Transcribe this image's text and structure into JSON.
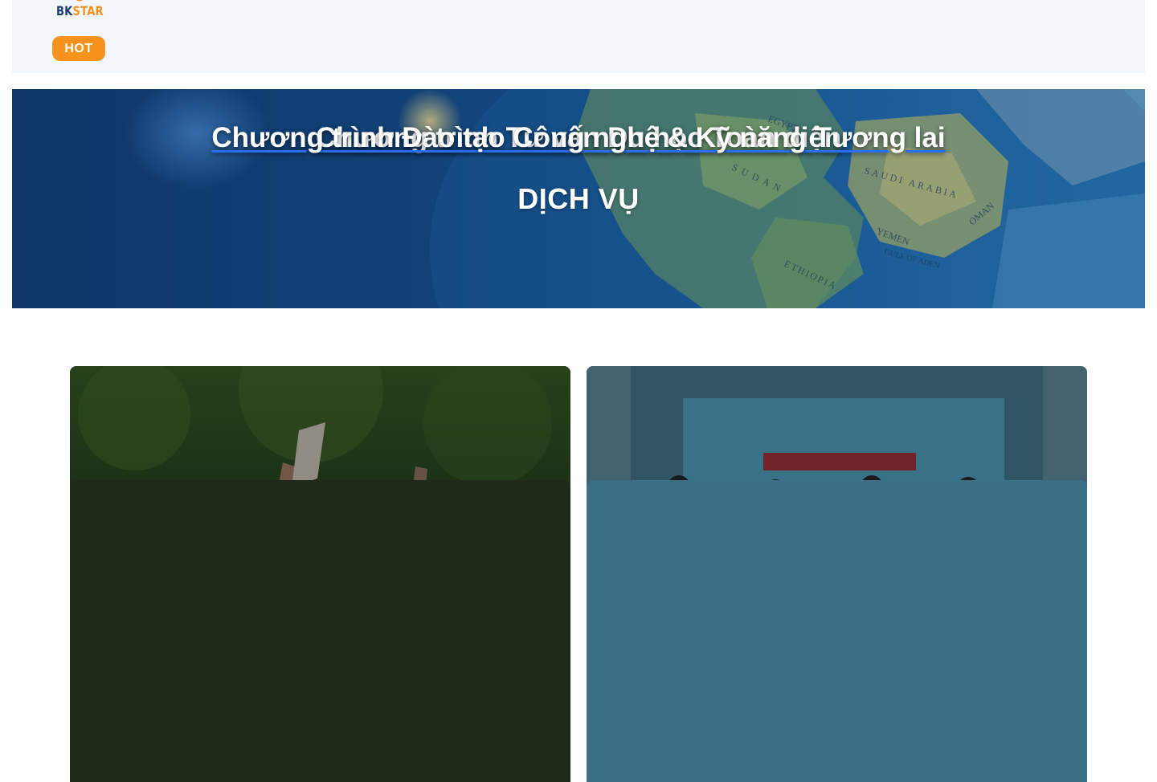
{
  "header": {
    "logo": {
      "part1": "BK",
      "part2": "STAR"
    },
    "hot_label": "HOT"
  },
  "hero": {
    "title": "DỊCH VỤ",
    "map_labels": [
      "EGYPT",
      "SUDAN",
      "SAUDI ARABIA",
      "ETHIOPIA",
      "YEMEN",
      "OMAN",
      "GULF OF ADEN"
    ]
  },
  "services": [
    {
      "title": "Chương trình Tư vấn Du học Toàn diện"
    },
    {
      "title": "Chương trình Đào tạo Công nghệ & Kỹ năng Tương lai"
    }
  ],
  "colors": {
    "brand_navy": "#1b3e77",
    "brand_orange": "#f7931d",
    "header_bg": "#f3f6fb",
    "link_underline": "#2a6ef0"
  }
}
